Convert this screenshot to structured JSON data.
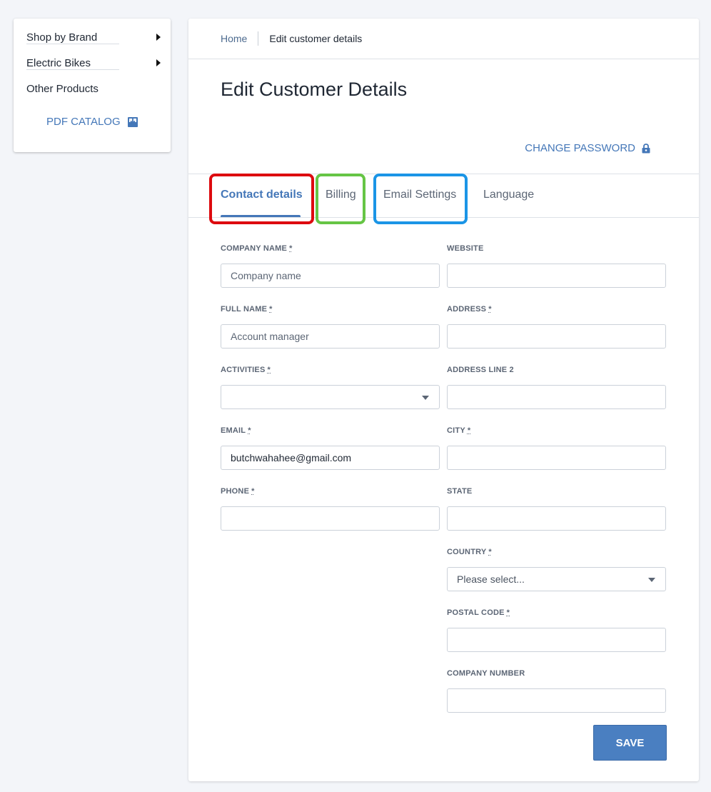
{
  "sidebar": {
    "items": [
      {
        "label": "Shop by Brand",
        "has_submenu": true
      },
      {
        "label": "Electric Bikes",
        "has_submenu": true
      },
      {
        "label": "Other Products",
        "has_submenu": false
      }
    ],
    "pdf_catalog_label": "PDF CATALOG"
  },
  "breadcrumb": {
    "home": "Home",
    "current": "Edit customer details"
  },
  "page_title": "Edit Customer Details",
  "change_password_label": "CHANGE PASSWORD",
  "tabs": [
    {
      "label": "Contact details",
      "active": true
    },
    {
      "label": "Billing",
      "active": false
    },
    {
      "label": "Email Settings",
      "active": false
    },
    {
      "label": "Language",
      "active": false
    }
  ],
  "highlight_colors": {
    "contact_details": "#dd0a0f",
    "billing": "#66c545",
    "email_settings": "#1b95e6"
  },
  "form": {
    "required_marker": "*",
    "company_name": {
      "label": "COMPANY NAME",
      "placeholder": "Company name",
      "value": ""
    },
    "website": {
      "label": "WEBSITE",
      "value": ""
    },
    "full_name": {
      "label": "FULL NAME",
      "placeholder": "Account manager",
      "value": ""
    },
    "address": {
      "label": "ADDRESS",
      "value": ""
    },
    "activities": {
      "label": "ACTIVITIES",
      "selected": ""
    },
    "address_line_2": {
      "label": "ADDRESS LINE 2",
      "value": ""
    },
    "email": {
      "label": "EMAIL",
      "value": "butchwahahee@gmail.com"
    },
    "city": {
      "label": "CITY",
      "value": ""
    },
    "phone": {
      "label": "PHONE",
      "value": ""
    },
    "state": {
      "label": "STATE",
      "value": ""
    },
    "country": {
      "label": "COUNTRY",
      "selected": "Please select..."
    },
    "postal_code": {
      "label": "POSTAL CODE",
      "value": ""
    },
    "company_number": {
      "label": "COMPANY NUMBER",
      "value": ""
    }
  },
  "save_label": "SAVE",
  "colors": {
    "accent": "#4477b8",
    "button": "#4a7fc1"
  }
}
